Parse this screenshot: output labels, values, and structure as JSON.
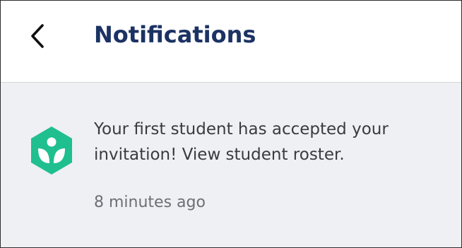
{
  "header": {
    "back_icon": "chevron-left-icon",
    "title": "Notifications"
  },
  "notifications": [
    {
      "icon": "khan-academy-logo",
      "icon_color": "#1fbf8f",
      "message": "Your first student has accepted your invitation! View student roster.",
      "time": "8 minutes ago"
    }
  ],
  "colors": {
    "title": "#1b3263",
    "content_background": "#eef0f3",
    "message_text": "#3a3b3d",
    "timestamp_text": "#6d6f74"
  }
}
